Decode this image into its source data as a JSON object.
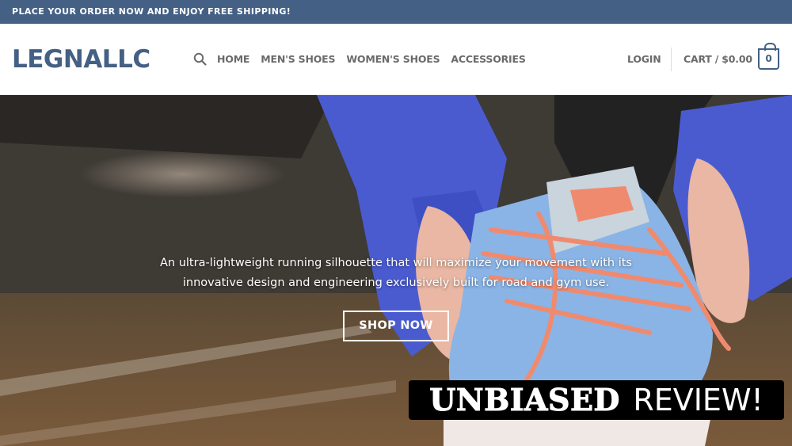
{
  "topbar": {
    "text": "PLACE YOUR ORDER NOW AND ENJOY FREE SHIPPING!"
  },
  "header": {
    "logo": "LEGNALLC",
    "nav": [
      "HOME",
      "MEN'S SHOES",
      "WOMEN'S SHOES",
      "ACCESSORIES"
    ],
    "login": "LOGIN",
    "cart_label": "CART / $0.00",
    "cart_count": "0"
  },
  "hero": {
    "description_line1": "An ultra-lightweight running silhouette that will maximize your movement with its",
    "description_line2": "innovative design and engineering exclusively built for road and gym use.",
    "button": "SHOP NOW",
    "badge_word1": "UNBIASED",
    "badge_word2": "REVIEW!"
  },
  "colors": {
    "brand": "#446084",
    "nav_text": "#6a6a6a",
    "glove": "#4a5bd0",
    "shoe": "#8ab4e6",
    "laces": "#f08a6e"
  }
}
